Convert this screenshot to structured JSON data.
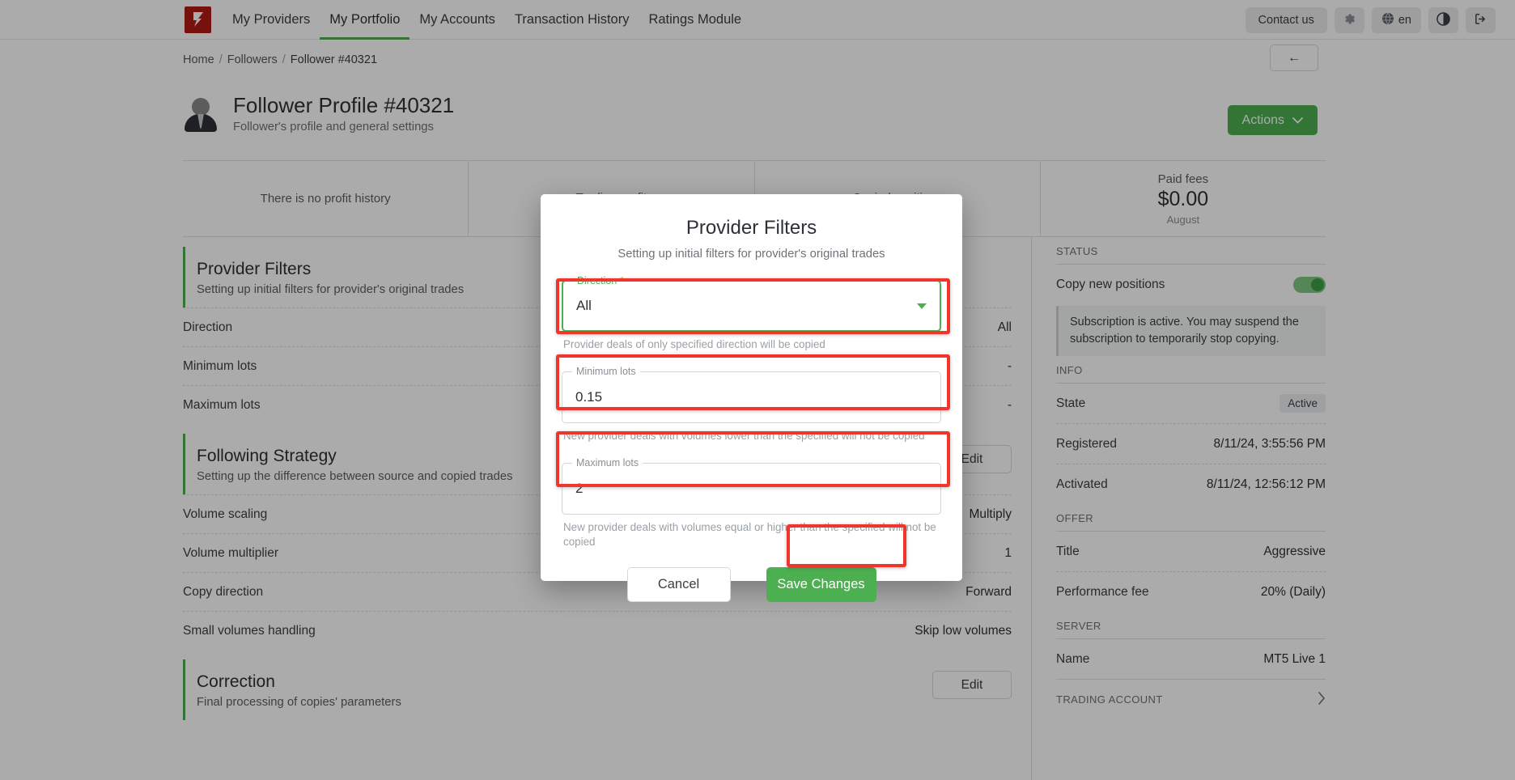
{
  "topnav": {
    "brand_color": "#b01a16",
    "links": [
      {
        "label": "My Providers",
        "active": false
      },
      {
        "label": "My Portfolio",
        "active": true
      },
      {
        "label": "My Accounts",
        "active": false
      },
      {
        "label": "Transaction History",
        "active": false
      },
      {
        "label": "Ratings Module",
        "active": false
      }
    ],
    "contact_label": "Contact us",
    "lang_label": "en"
  },
  "breadcrumb": {
    "home": "Home",
    "sep": "/",
    "followers": "Followers",
    "current": "Follower #40321",
    "back_label": "←"
  },
  "profile": {
    "title": "Follower Profile #40321",
    "subtitle": "Follower's profile and general settings",
    "actions_label": "Actions"
  },
  "stats": [
    {
      "label": "There is no profit history",
      "value": "",
      "note": "",
      "empty": true
    },
    {
      "label": "Trading profit",
      "value": "",
      "note": "",
      "empty": false
    },
    {
      "label": "Copied positions",
      "value": "",
      "note": "",
      "empty": false
    },
    {
      "label": "Paid fees",
      "value": "$0.00",
      "note": "August",
      "empty": false
    }
  ],
  "sections": {
    "provider_filters": {
      "title": "Provider Filters",
      "subtitle": "Setting up initial filters for provider's original trades",
      "rows": [
        {
          "key": "Direction",
          "value": "All"
        },
        {
          "key": "Minimum lots",
          "value": "-"
        },
        {
          "key": "Maximum lots",
          "value": "-"
        }
      ]
    },
    "following_strategy": {
      "title": "Following Strategy",
      "subtitle": "Setting up the difference between source and copied trades",
      "edit_label": "Edit",
      "rows": [
        {
          "key": "Volume scaling",
          "value": "Multiply"
        },
        {
          "key": "Volume multiplier",
          "value": "1"
        },
        {
          "key": "Copy direction",
          "value": "Forward"
        },
        {
          "key": "Small volumes handling",
          "value": "Skip low volumes"
        }
      ]
    },
    "correction": {
      "title": "Correction",
      "subtitle": "Final processing of copies' parameters",
      "edit_label": "Edit"
    }
  },
  "sidebar": {
    "status_caption": "STATUS",
    "copy_new_positions_label": "Copy new positions",
    "copy_new_positions_on": true,
    "subscription_note": "Subscription is active. You may suspend the subscription to temporarily stop copying.",
    "info_caption": "INFO",
    "info_rows": [
      {
        "key": "State",
        "value": "Active",
        "badge": true
      },
      {
        "key": "Registered",
        "value": "8/11/24, 3:55:56 PM",
        "badge": false
      },
      {
        "key": "Activated",
        "value": "8/11/24, 12:56:12 PM",
        "badge": false
      }
    ],
    "offer_caption": "OFFER",
    "offer_rows": [
      {
        "key": "Title",
        "value": "Aggressive"
      },
      {
        "key": "Performance fee",
        "value": "20% (Daily)"
      }
    ],
    "server_caption": "SERVER",
    "server_rows": [
      {
        "key": "Name",
        "value": "MT5 Live 1"
      }
    ],
    "trading_account_caption": "TRADING ACCOUNT",
    "chevron": "›"
  },
  "modal": {
    "title": "Provider Filters",
    "subtitle": "Setting up initial filters for provider's original trades",
    "fields": [
      {
        "legend": "Direction",
        "required": true,
        "value": "All",
        "help": "Provider deals of only specified direction will be copied",
        "focused": true,
        "dropdown": true
      },
      {
        "legend": "Minimum lots",
        "required": false,
        "value": "0.15",
        "help": "New provider deals with volumes lower than the specified will not be copied",
        "focused": false,
        "dropdown": false
      },
      {
        "legend": "Maximum lots",
        "required": false,
        "value": "2",
        "help": "New provider deals with volumes equal or higher than the specified will not be copied",
        "focused": false,
        "dropdown": false
      }
    ],
    "cancel_label": "Cancel",
    "save_label": "Save Changes",
    "highlight_color": "#f0352d",
    "accent_color": "#4caf50"
  }
}
